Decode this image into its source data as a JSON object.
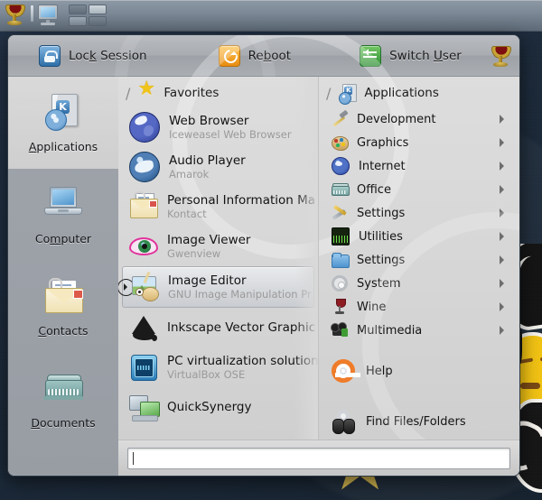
{
  "panel": {
    "items": [
      {
        "name": "kickoff-launcher",
        "icon": "chalice-icon",
        "label": "Application Launcher"
      },
      {
        "name": "show-desktop",
        "icon": "monitor-icon",
        "label": "Show Desktop"
      },
      {
        "name": "pager",
        "icon": "pager-icon",
        "label": "Desktop Pager"
      }
    ]
  },
  "kickoff": {
    "header": {
      "actions": [
        {
          "label_pre": "Loc",
          "mnemonic": "k",
          "label_post": " Session",
          "icon": "lock-icon"
        },
        {
          "label_pre": "Re",
          "mnemonic": "b",
          "label_post": "oot",
          "icon": "reboot-icon"
        },
        {
          "label_pre": "Switch ",
          "mnemonic": "U",
          "label_post": "ser",
          "icon": "switch-user-icon"
        }
      ],
      "brand_icon": "chalice-icon"
    },
    "sidebar": {
      "items": [
        {
          "mnemonic": "A",
          "rest": "pplications",
          "pre": "",
          "icon": "applications-icon",
          "selected": true
        },
        {
          "pre": "Co",
          "mnemonic": "m",
          "rest": "puter",
          "icon": "computer-icon",
          "selected": false
        },
        {
          "pre": "",
          "mnemonic": "C",
          "rest": "ontacts",
          "icon": "contacts-icon",
          "selected": false
        },
        {
          "pre": "",
          "mnemonic": "D",
          "rest": "ocuments",
          "icon": "documents-icon",
          "selected": false
        }
      ]
    },
    "favorites": {
      "title": "Favorites",
      "icon": "star-icon",
      "separator": "/",
      "items": [
        {
          "title": "Web Browser",
          "subtitle": "Iceweasel Web Browser",
          "icon": "web-browser-icon",
          "hovered": false
        },
        {
          "title": "Audio Player",
          "subtitle": "Amarok",
          "icon": "audio-player-icon",
          "hovered": false
        },
        {
          "title": "Personal Information Ma",
          "subtitle": "Kontact",
          "icon": "kontact-icon",
          "hovered": false
        },
        {
          "title": "Image Viewer",
          "subtitle": "Gwenview",
          "icon": "image-viewer-icon",
          "hovered": false
        },
        {
          "title": "Image Editor",
          "subtitle": "GNU Image Manipulation Pr",
          "icon": "gimp-icon",
          "hovered": true
        },
        {
          "title": "Inkscape Vector Graphic",
          "subtitle": "",
          "icon": "inkscape-icon",
          "hovered": false
        },
        {
          "title": "PC virtualization solution",
          "subtitle": "VirtualBox OSE",
          "icon": "virtualbox-icon",
          "hovered": false
        },
        {
          "title": "QuickSynergy",
          "subtitle": "",
          "icon": "quicksynergy-icon",
          "hovered": false
        }
      ]
    },
    "applications": {
      "title": "Applications",
      "icon": "applications-small-icon",
      "separator": "/",
      "categories": [
        {
          "label": "Development",
          "icon": "hammer-icon",
          "submenu": true
        },
        {
          "label": "Graphics",
          "icon": "palette-icon",
          "submenu": true
        },
        {
          "label": "Internet",
          "icon": "globe-icon",
          "submenu": true
        },
        {
          "label": "Office",
          "icon": "typewriter-icon",
          "submenu": true
        },
        {
          "label": "Settings",
          "icon": "tools-icon",
          "submenu": true
        },
        {
          "label": "Utilities",
          "icon": "terminal-icon",
          "submenu": true
        },
        {
          "label": "Settings",
          "icon": "folder-icon",
          "submenu": true
        },
        {
          "label": "System",
          "icon": "gear-icon",
          "submenu": true
        },
        {
          "label": "Wine",
          "icon": "wine-glass-icon",
          "submenu": true
        },
        {
          "label": "Multimedia",
          "icon": "multimedia-icon",
          "submenu": true
        }
      ],
      "extras": [
        {
          "label": "Help",
          "icon": "lifebuoy-icon",
          "submenu": false
        },
        {
          "label": "Find Files/Folders",
          "icon": "binoculars-icon",
          "submenu": false
        }
      ]
    },
    "search": {
      "value": "",
      "placeholder": ""
    }
  },
  "colors": {
    "desktop": "#1d2b3c",
    "menu_bg": "#d3d3d3",
    "header_bg": "#a9acb1",
    "sidebar_bg": "#9fa4ab",
    "accent_star": "#f0c419",
    "subtitle": "#9a9a9a"
  }
}
